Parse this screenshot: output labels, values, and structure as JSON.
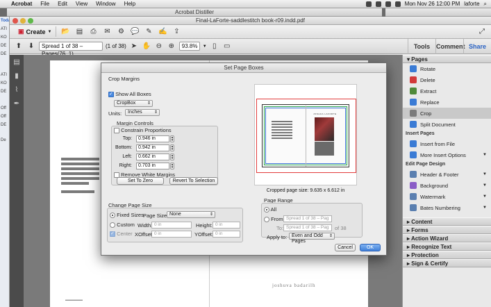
{
  "menubar": {
    "app": "Acrobat",
    "menus": [
      "File",
      "Edit",
      "View",
      "Window",
      "Help"
    ],
    "datetime": "Mon Nov 26  12:00 PM",
    "user": "laforte"
  },
  "background_window": {
    "title": "Acrobat Distiller"
  },
  "left_strip": [
    "Today",
    "ATI",
    "KO",
    "DE",
    "DE",
    "ATI",
    "KO",
    "DE",
    "Off",
    "Off",
    "DE",
    "De"
  ],
  "window": {
    "title": "Final-LaForte-saddlestitch book-r09.indd.pdf"
  },
  "toolbar": {
    "create_label": "Create",
    "page_field": "Spread 1 of 38 – Pages(76, 1)",
    "page_count": "(1 of 38)",
    "zoom": "93.8%",
    "tabs": {
      "tools": "Tools",
      "comment": "Comment",
      "share": "Share"
    }
  },
  "right_panel": {
    "pages_header": "Pages",
    "pages_items": [
      "Rotate",
      "Delete",
      "Extract",
      "Replace",
      "Crop",
      "Split Document"
    ],
    "insert_header": "Insert Pages",
    "insert_items": [
      "Insert from File",
      "More Insert Options"
    ],
    "design_header": "Edit Page Design",
    "design_items": [
      "Header & Footer",
      "Background",
      "Watermark",
      "Bates Numbering"
    ],
    "collapsed_sections": [
      "Content",
      "Forms",
      "Action Wizard",
      "Recognize Text",
      "Protection",
      "Sign & Certify"
    ],
    "colors": {
      "rotate": "#3a7bd5",
      "delete": "#d23a3a",
      "extract": "#4f8a3a",
      "replace": "#3a7bd5",
      "crop": "#7a7a7a",
      "split": "#3a7bd5"
    }
  },
  "document": {
    "footer_text": "joshuva badarilh"
  },
  "dialog": {
    "title": "Set Page Boxes",
    "crop_margins_label": "Crop Margins",
    "show_all_boxes": "Show All Boxes",
    "box_select": "CropBox",
    "units_label": "Units:",
    "units_value": "Inches",
    "margin_controls_label": "Margin Controls",
    "constrain": "Constrain Proportions",
    "top_label": "Top:",
    "top_value": "0.946 in",
    "bottom_label": "Bottom:",
    "bottom_value": "0.942 in",
    "left_label": "Left:",
    "left_value": "0.662 in",
    "right_label": "Right:",
    "right_value": "0.703 in",
    "remove_white": "Remove White Margins",
    "set_to_zero": "Set To Zero",
    "revert": "Revert To Selection",
    "cropped_size": "Cropped page size: 9.635 x 6.612 in",
    "change_page_size_label": "Change Page Size",
    "fixed_sizes": "Fixed Sizes",
    "page_sizes_label": "Page Sizes:",
    "page_sizes_value": "None",
    "custom": "Custom",
    "width_label": "Width:",
    "width_value": "0 in",
    "height_label": "Height:",
    "height_value": "0 in",
    "center": "Center",
    "xoffset_label": "XOffset:",
    "xoffset_value": "0 in",
    "yoffset_label": "YOffset:",
    "yoffset_value": "0 in",
    "page_range_label": "Page Range",
    "all": "All",
    "from_label": "From:",
    "from_value": "Spread 1 of 38 – Pag",
    "to_label": "To:",
    "to_value": "Spread 1 of 38 – Pag",
    "of_text": "of 38",
    "apply_to_label": "Apply to:",
    "apply_to_value": "Even and Odd Pages",
    "cancel": "Cancel",
    "ok": "OK",
    "preview_title": "JOSHUA LAFORTE"
  }
}
